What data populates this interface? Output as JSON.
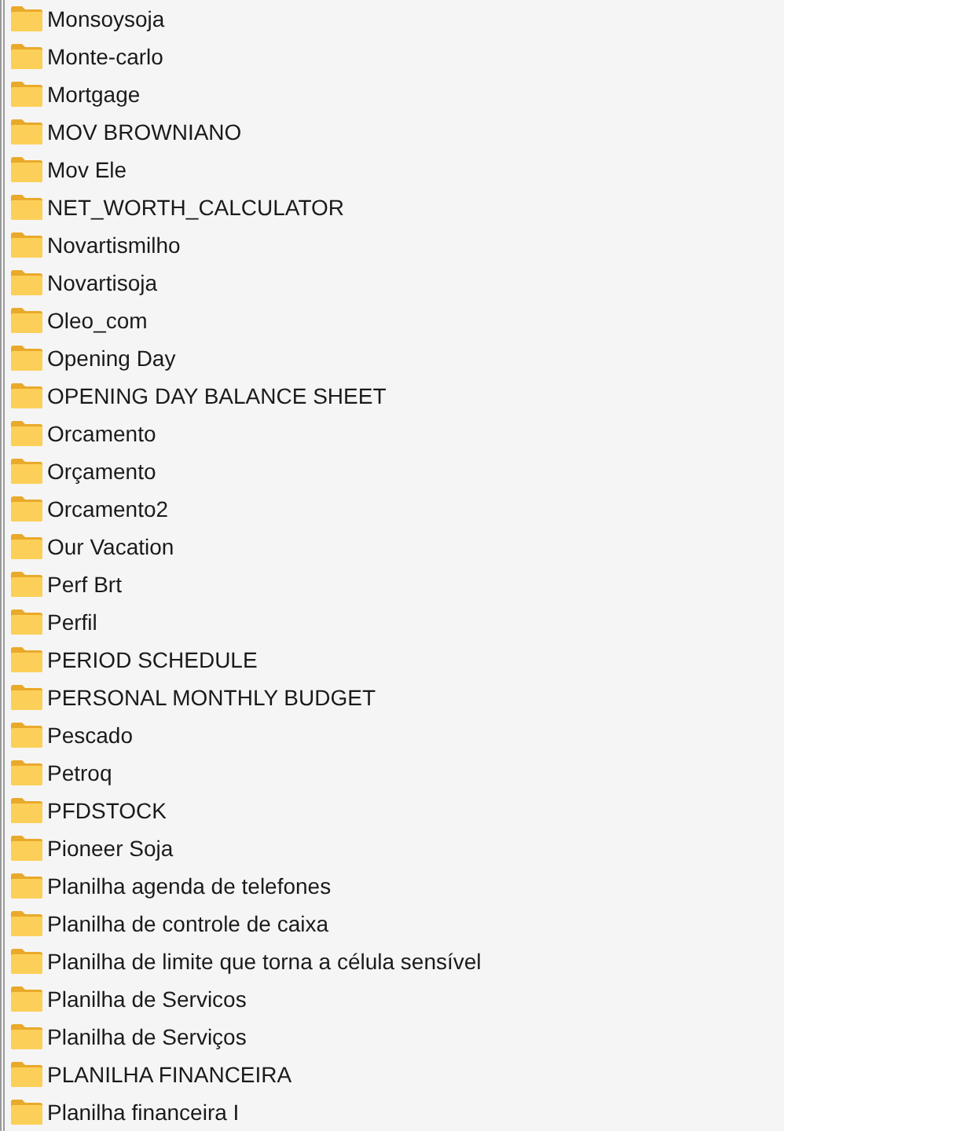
{
  "folders": [
    {
      "name": "Monsoysoja"
    },
    {
      "name": "Monte-carlo"
    },
    {
      "name": "Mortgage"
    },
    {
      "name": "MOV BROWNIANO"
    },
    {
      "name": "Mov Ele"
    },
    {
      "name": "NET_WORTH_CALCULATOR"
    },
    {
      "name": "Novartismilho"
    },
    {
      "name": "Novartisoja"
    },
    {
      "name": "Oleo_com"
    },
    {
      "name": "Opening Day"
    },
    {
      "name": "OPENING DAY BALANCE SHEET"
    },
    {
      "name": "Orcamento"
    },
    {
      "name": "Orçamento"
    },
    {
      "name": "Orcamento2"
    },
    {
      "name": "Our Vacation"
    },
    {
      "name": "Perf Brt"
    },
    {
      "name": "Perfil"
    },
    {
      "name": "PERIOD SCHEDULE"
    },
    {
      "name": "PERSONAL MONTHLY BUDGET"
    },
    {
      "name": "Pescado"
    },
    {
      "name": "Petroq"
    },
    {
      "name": "PFDSTOCK"
    },
    {
      "name": "Pioneer Soja"
    },
    {
      "name": "Planilha agenda de telefones"
    },
    {
      "name": "Planilha de controle de caixa"
    },
    {
      "name": "Planilha de limite que torna a célula sensível"
    },
    {
      "name": "Planilha de Servicos"
    },
    {
      "name": "Planilha de Serviços"
    },
    {
      "name": "PLANILHA FINANCEIRA"
    },
    {
      "name": "Planilha financeira I"
    }
  ]
}
